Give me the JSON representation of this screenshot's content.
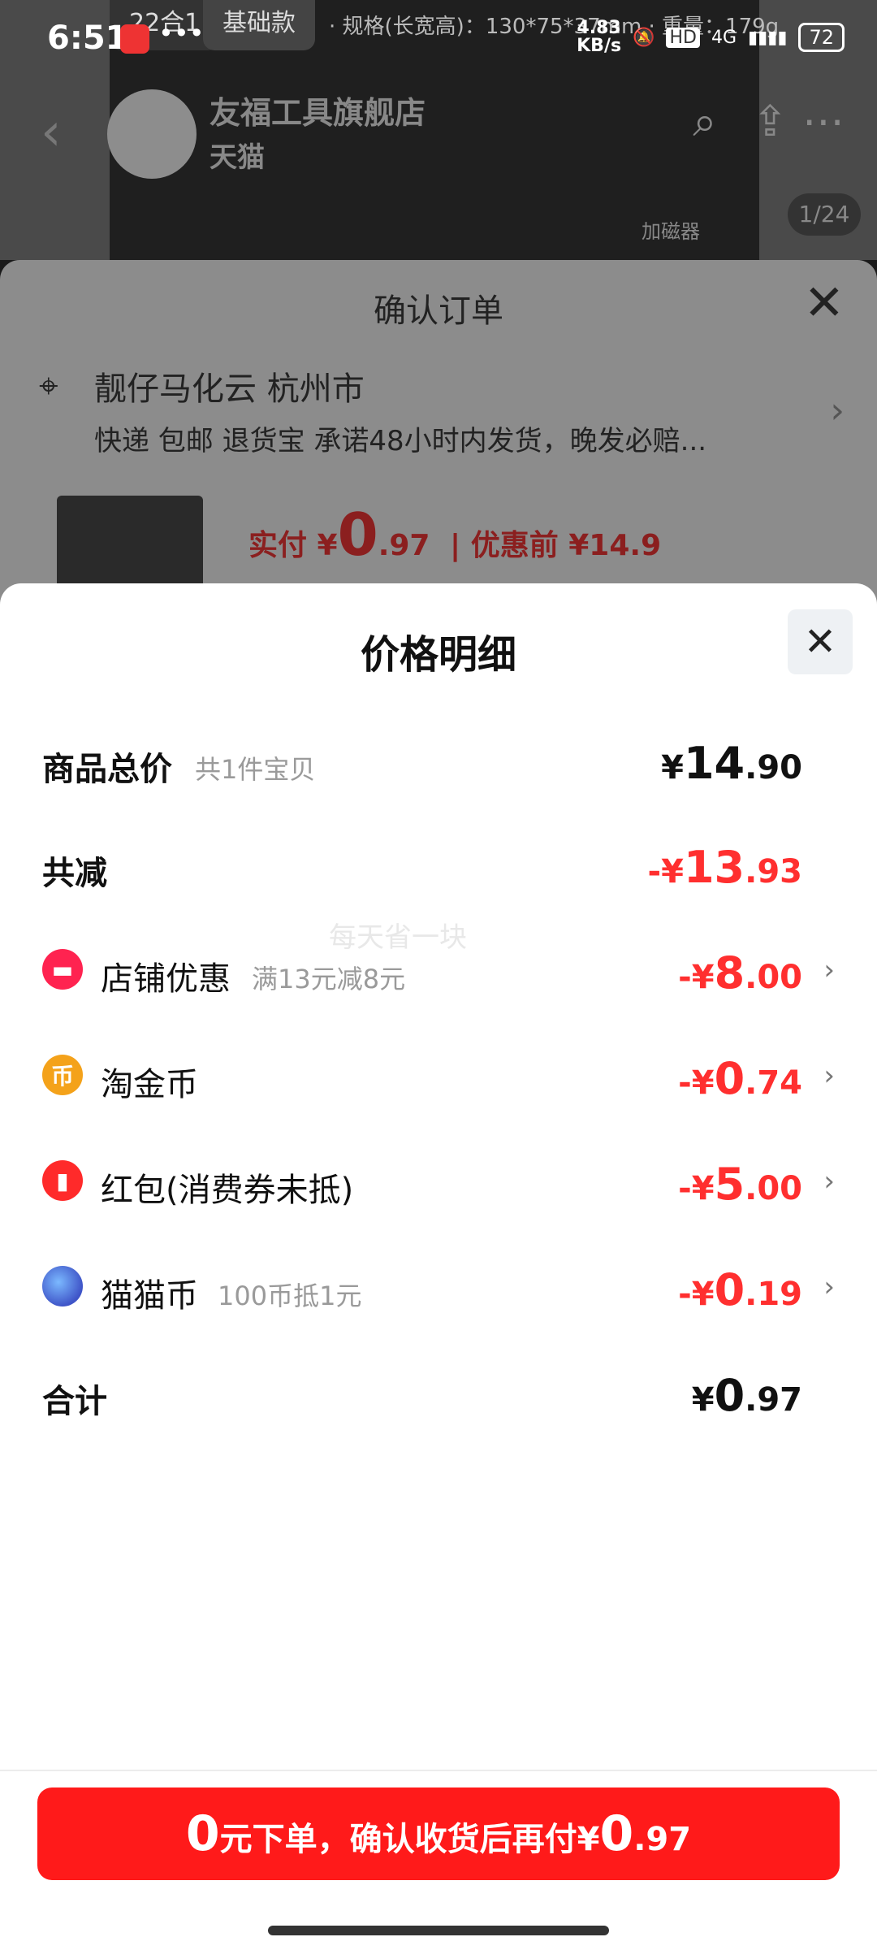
{
  "status": {
    "time": "6:51",
    "dots": "•••",
    "speed_value": "4.83",
    "speed_unit": "KB/s",
    "hd": "HD",
    "net": "4G",
    "battery": "72"
  },
  "background": {
    "chip1": "22合1",
    "chip2": "基础款",
    "spec": "· 规格(长宽高)：130*75*37mm  · 重量：179g",
    "store_name": "友福工具旗舰店",
    "store_sub": "天猫",
    "counter": "1/24",
    "magnet_label": "加磁器"
  },
  "order": {
    "title": "确认订单",
    "address_name": "靓仔马化云 杭州市",
    "address_desc": "快递 包邮 退货宝 承诺48小时内发货，晚发必赔...",
    "pay_prefix": "实付 ¥",
    "pay_int": "0",
    "pay_dec": ".97",
    "before_label": "| 优惠前 ¥14.9"
  },
  "detail": {
    "title": "价格明细",
    "watermark": "每天省一块",
    "rows": [
      {
        "label": "商品总价",
        "hint": "共1件宝贝",
        "sign": "¥",
        "int": "14",
        "dec": ".90"
      },
      {
        "label": "共减",
        "hint": "",
        "sign": "-¥",
        "int": "13",
        "dec": ".93"
      },
      {
        "label": "店铺优惠",
        "hint": "满13元减8元",
        "sign": "-¥",
        "int": "8",
        "dec": ".00"
      },
      {
        "label": "淘金币",
        "hint": "",
        "sign": "-¥",
        "int": "0",
        "dec": ".74"
      },
      {
        "label": "红包(消费券未抵)",
        "hint": "",
        "sign": "-¥",
        "int": "5",
        "dec": ".00"
      },
      {
        "label": "猫猫币",
        "hint": "100币抵1元",
        "sign": "-¥",
        "int": "0",
        "dec": ".19"
      },
      {
        "label": "合计",
        "hint": "",
        "sign": "¥",
        "int": "0",
        "dec": ".97"
      }
    ],
    "icons": {
      "coin_glyph": "币"
    }
  },
  "cta": {
    "big": "0",
    "middle": "元下单，确认收货后再付",
    "sign": "¥",
    "int": "0",
    "dec": ".97"
  },
  "colors": {
    "accent": "#ff1a1a",
    "discount": "#ff2f2f"
  }
}
